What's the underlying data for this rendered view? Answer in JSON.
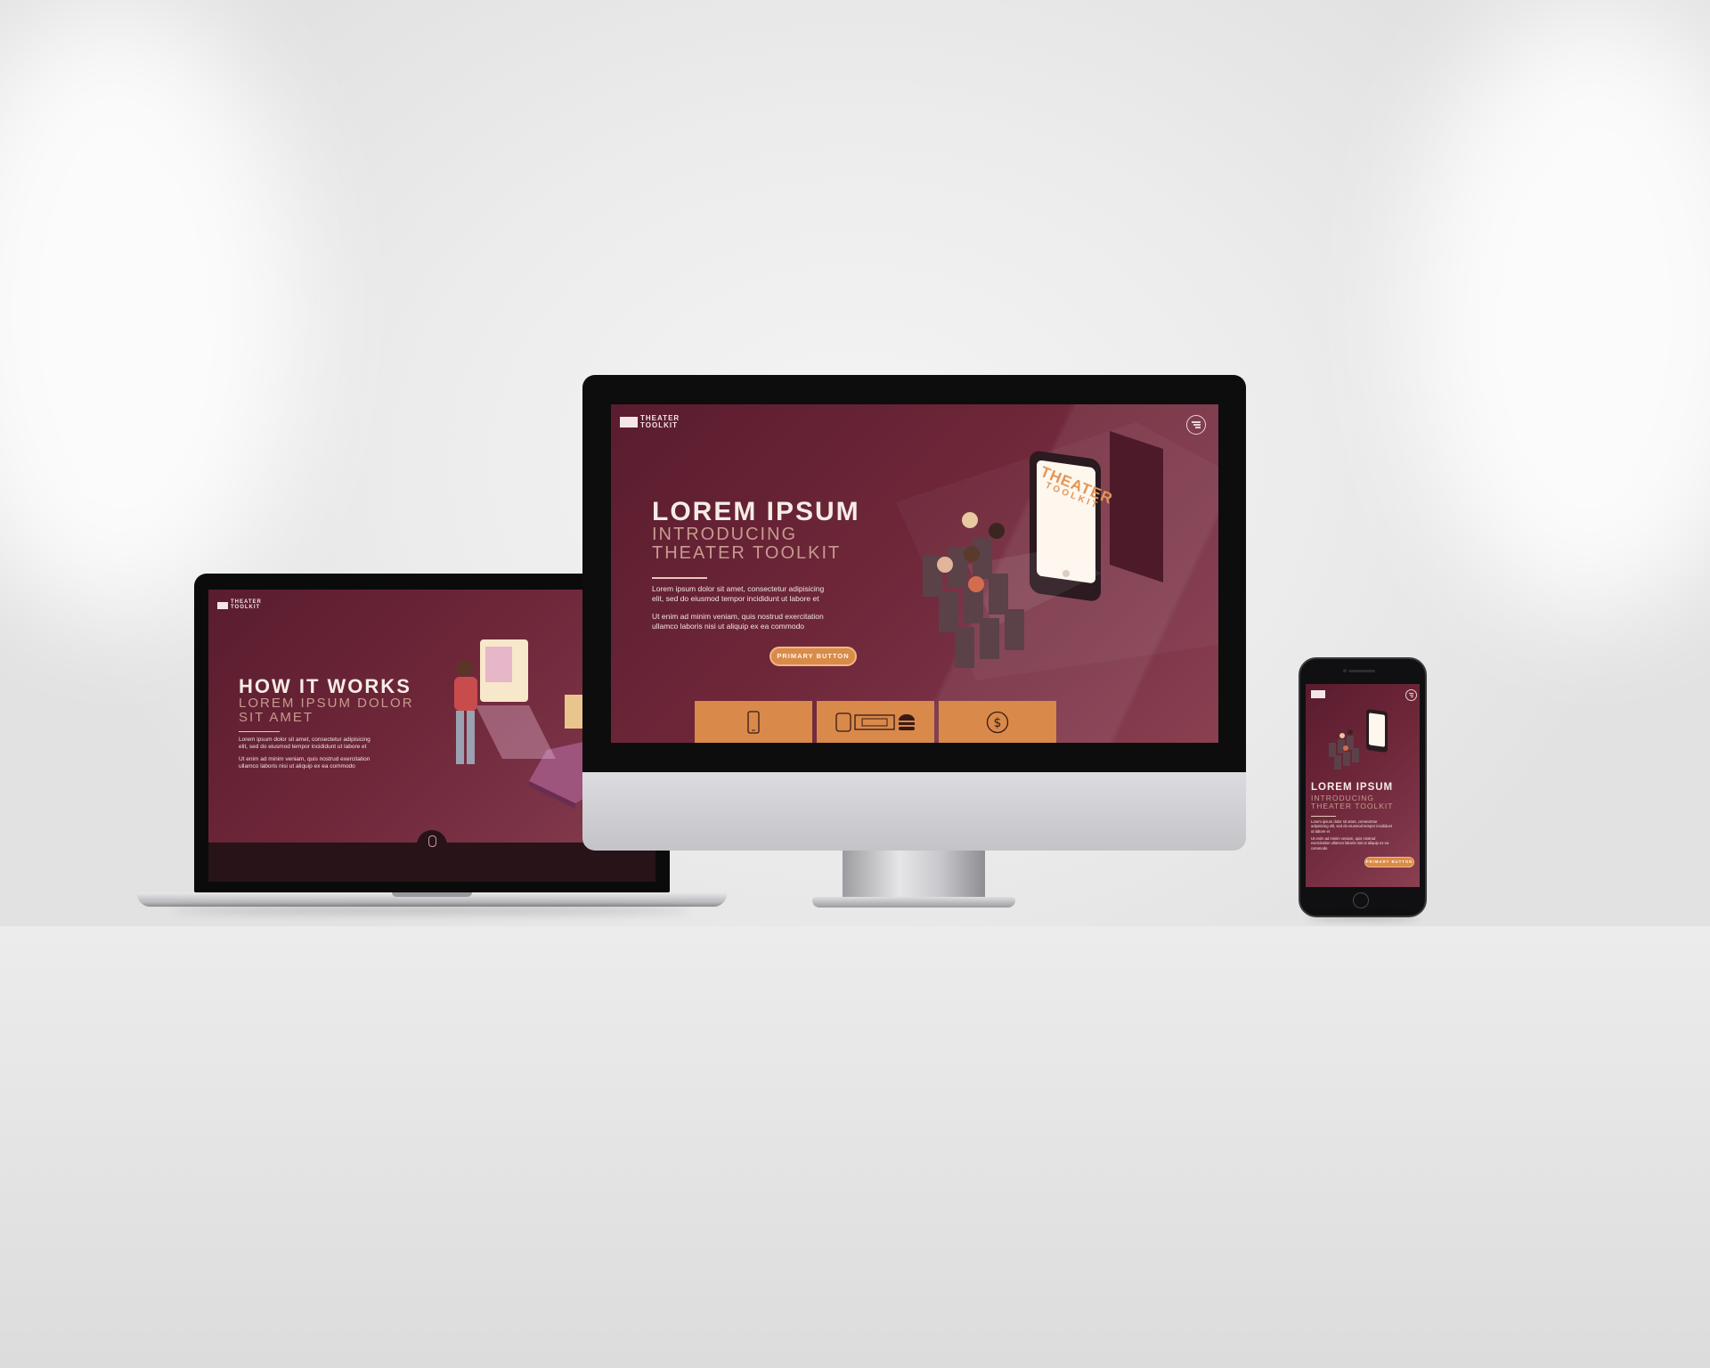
{
  "brand": {
    "line1": "THEATER",
    "line2": "TOOLKIT"
  },
  "laptop": {
    "heading": "HOW IT WORKS",
    "subheading_line1": "LOREM IPSUM DOLOR",
    "subheading_line2": "SIT AMET",
    "para1_line1": "Lorem ipsum dolor sit amet, consectetur adipisicing",
    "para1_line2": "elit, sed do eiusmod tempor incididunt ut labore et",
    "para2_line1": "Ut enim ad minim veniam, quis nostrud exercitation",
    "para2_line2": "ullamco laboris nisi ut aliquip ex ea commodo",
    "scroll_icon": "mouse-icon"
  },
  "desktop": {
    "heading": "LOREM IPSUM",
    "subheading_line1": "INTRODUCING",
    "subheading_line2": "THEATER TOOLKIT",
    "para1_line1": "Lorem ipsum dolor sit amet, consectetur adipisicing",
    "para1_line2": "elit, sed do eiusmod tempor incididunt ut labore et",
    "para2_line1": "Ut enim ad minim veniam, quis nostrud exercitation",
    "para2_line2": "ullamco laboris nisi ut aliquip ex ea commodo",
    "button": "PRIMARY BUTTON",
    "phone_sign_line1": "THEATER",
    "phone_sign_line2": "TOOLKIT",
    "tiles": [
      {
        "icon": "smartphone-icon"
      },
      {
        "icon": "seat-ticket-burger-icon"
      },
      {
        "icon": "dollar-icon"
      }
    ],
    "menu_icon": "hamburger-menu-icon"
  },
  "phone": {
    "heading": "LOREM IPSUM",
    "subheading_line1": "INTRODUCING",
    "subheading_line2": "THEATER TOOLKIT",
    "para1_line1": "Lorem ipsum dolor sit amet, consectetur",
    "para1_line2": "adipisicing elit, sed do eiusmod tempor incididunt",
    "para1_line3": "ut labore et",
    "para2_line1": "Ut enim ad minim veniam, quis nostrud",
    "para2_line2": "exercitation ullamco laboris nisi ut aliquip ex ea",
    "para2_line3": "commodo",
    "button": "PRIMARY BUTTON"
  },
  "colors": {
    "accent": "#d9894a",
    "background": "#6e2739",
    "text": "#f6ece6"
  }
}
